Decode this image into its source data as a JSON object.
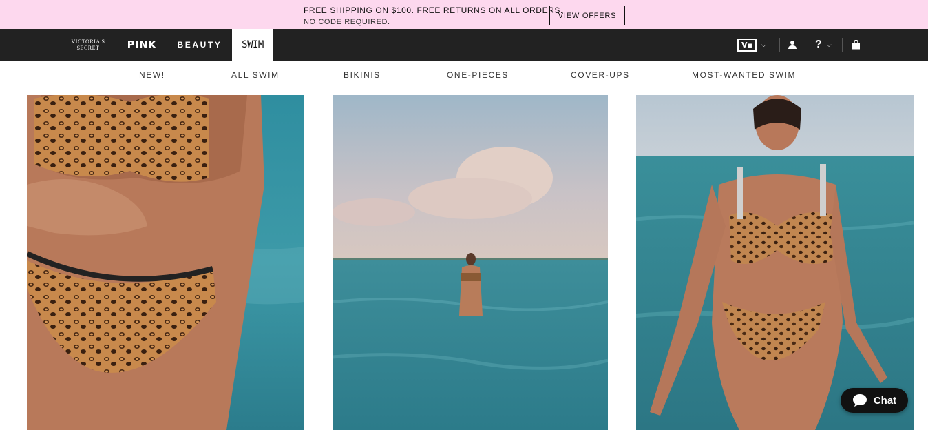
{
  "promo": {
    "line1": "FREE SHIPPING ON $100. FREE RETURNS ON ALL ORDERS.",
    "line2": "NO CODE REQUIRED.",
    "button": "VIEW OFFERS",
    "bg_color": "#fdd8ee"
  },
  "topnav": {
    "bg_color": "#222222",
    "brands": {
      "vs_line1": "VICTORIA'S",
      "vs_line2": "SECRET",
      "pink": "PINK",
      "beauty": "BEAUTY",
      "swim": "SWIM"
    },
    "icons": {
      "vs_logo_text": "V▪",
      "account": "user-icon",
      "help": "?",
      "bag": "shopping-bag-icon"
    }
  },
  "subnav": {
    "items": [
      "NEW!",
      "ALL SWIM",
      "BIKINIS",
      "ONE-PIECES",
      "COVER-UPS",
      "MOST-WANTED SWIM"
    ]
  },
  "chat": {
    "label": "Chat"
  }
}
